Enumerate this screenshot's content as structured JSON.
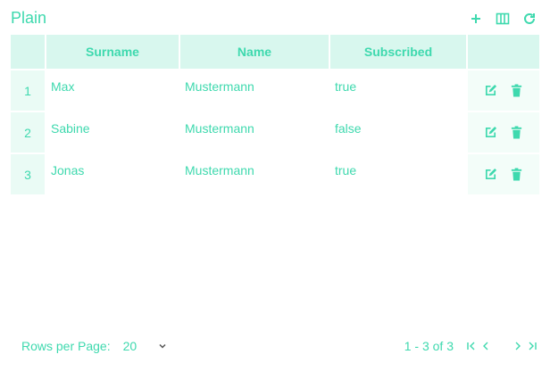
{
  "header": {
    "title": "Plain",
    "accent": "#3ed9ae",
    "toolbar_icons": [
      "plus-icon",
      "columns-icon",
      "refresh-icon"
    ]
  },
  "table": {
    "columns": [
      "",
      "Surname",
      "Name",
      "Subscribed",
      ""
    ],
    "rows": [
      {
        "index": "1",
        "surname": "Max",
        "name": "Mustermann",
        "subscribed": "true"
      },
      {
        "index": "2",
        "surname": "Sabine",
        "name": "Mustermann",
        "subscribed": "false"
      },
      {
        "index": "3",
        "surname": "Jonas",
        "name": "Mustermann",
        "subscribed": "true"
      }
    ],
    "row_actions": [
      "edit-icon",
      "trash-icon"
    ]
  },
  "footer": {
    "rows_per_page_label": "Rows per Page:",
    "rows_per_page_value": "20",
    "page_info": "1 - 3 of 3"
  }
}
